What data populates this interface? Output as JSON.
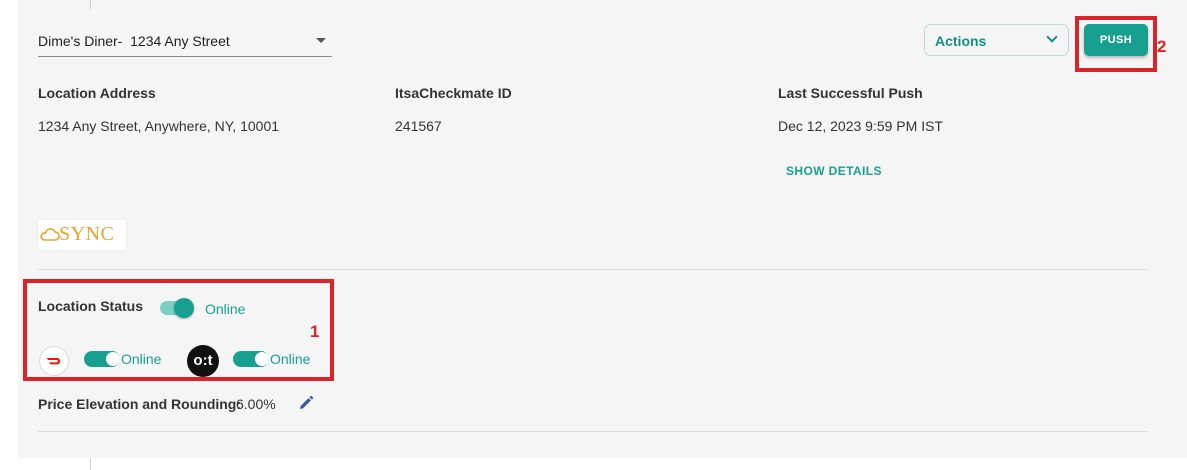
{
  "location_select": {
    "value": "Dime's Diner-  1234 Any Street"
  },
  "actions_dropdown": {
    "label": "Actions"
  },
  "push_button": {
    "label": "PUSH"
  },
  "annotations": {
    "marker_1": "1",
    "marker_2": "2"
  },
  "info": {
    "address_header": "Location Address",
    "address_value": "1234 Any Street, Anywhere, NY, 10001",
    "id_header": "ItsaCheckmate ID",
    "id_value": "241567",
    "push_header": "Last Successful Push",
    "push_value": "Dec 12, 2023 9:59 PM IST",
    "show_details": "SHOW DETAILS"
  },
  "sync_logo": {
    "text": "SYNC"
  },
  "location_status": {
    "label": "Location Status",
    "status_text": "Online",
    "toggle_on": true
  },
  "channels": [
    {
      "icon": "doordash-icon",
      "status_text": "Online",
      "toggle_on": true
    },
    {
      "icon": "ot-icon",
      "logo_text": "o:t",
      "status_text": "Online",
      "toggle_on": true
    }
  ],
  "price_elevation": {
    "label": "Price Elevation and Rounding:",
    "value": "6.00%"
  },
  "colors": {
    "accent": "#17a090",
    "annotation_red": "#d9252a",
    "doordash_red": "#eb1700",
    "sync_orange": "#e8a22a"
  }
}
